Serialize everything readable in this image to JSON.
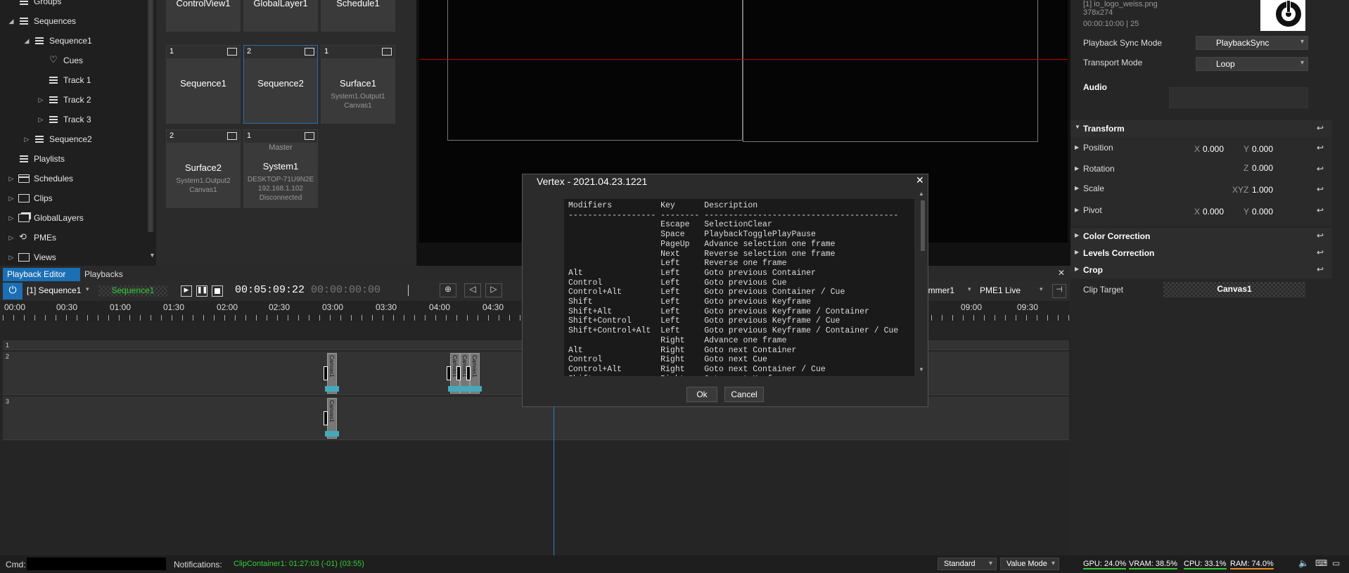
{
  "tree": {
    "items": [
      {
        "label": "Groups",
        "icon": "list-icon",
        "level": 0
      },
      {
        "label": "Sequences",
        "icon": "list-icon",
        "level": 0
      },
      {
        "label": "Sequence1",
        "icon": "list-icon",
        "level": 1
      },
      {
        "label": "Cues",
        "icon": "cue-icon",
        "level": 2
      },
      {
        "label": "Track 1",
        "icon": "list-icon",
        "level": 2
      },
      {
        "label": "Track 2",
        "icon": "list-icon",
        "level": 2
      },
      {
        "label": "Track 3",
        "icon": "list-icon",
        "level": 2
      },
      {
        "label": "Sequence2",
        "icon": "list-icon",
        "level": 1
      },
      {
        "label": "Playlists",
        "icon": "list-icon",
        "level": 0
      },
      {
        "label": "Schedules",
        "icon": "calendar-icon",
        "level": 0
      },
      {
        "label": "Clips",
        "icon": "clip-icon",
        "level": 0
      },
      {
        "label": "GlobalLayers",
        "icon": "layer-icon",
        "level": 0
      },
      {
        "label": "PMEs",
        "icon": "pme-icon",
        "level": 0
      },
      {
        "label": "Views",
        "icon": "view-icon",
        "level": 0
      }
    ]
  },
  "tiles": [
    {
      "name": "ControlView1"
    },
    {
      "name": "GlobalLayer1"
    },
    {
      "name": "Schedule1"
    },
    {
      "num": "1",
      "name": "Sequence1"
    },
    {
      "num": "2",
      "name": "Sequence2"
    },
    {
      "num": "1",
      "name": "Surface1",
      "sub1": "System1.Output1",
      "sub2": "Canvas1"
    },
    {
      "num": "2",
      "name": "Surface2",
      "sub1": "System1.Output2",
      "sub2": "Canvas1"
    },
    {
      "num": "1",
      "head": "Master",
      "name": "System1",
      "sub1": "DESKTOP-71U9N2E",
      "sub2": "192.168.1.102",
      "sub3": "Disconnected"
    }
  ],
  "props": {
    "file_name": "[1] io_logo_weiss.png",
    "file_size": "378x274",
    "file_time": "00:00:10:00 | 25",
    "playback_sync_label": "Playback Sync Mode",
    "playback_sync_value": "PlaybackSync",
    "transport_label": "Transport Mode",
    "transport_value": "Loop",
    "audio_label": "Audio",
    "transform_label": "Transform",
    "position_label": "Position",
    "pos_x_lbl": "X",
    "pos_x": "0.000",
    "pos_y_lbl": "Y",
    "pos_y": "0.000",
    "rotation_label": "Rotation",
    "rot_z_lbl": "Z",
    "rot_z": "0.000",
    "scale_label": "Scale",
    "scale_lbl": "XYZ",
    "scale_val": "1.000",
    "pivot_label": "Pivot",
    "piv_x_lbl": "X",
    "piv_x": "0.000",
    "piv_y_lbl": "Y",
    "piv_y": "0.000",
    "color_correction": "Color Correction",
    "levels_correction": "Levels Correction",
    "crop": "Crop",
    "clip_target_label": "Clip Target",
    "clip_target_value": "Canvas1"
  },
  "editor": {
    "tab1": "Playback Editor",
    "tab2": "Playbacks",
    "sequence_select": "[1] Sequence1",
    "sequence_name": "Sequence1",
    "timecode": "00:05:09:22",
    "timecode2": "00:00:00:00",
    "programmer": "ammer1",
    "pme": "PME1 Live",
    "ruler_ticks": [
      "00:00",
      "00:30",
      "01:00",
      "01:30",
      "02:00",
      "02:30",
      "03:00",
      "03:30",
      "04:00",
      "04:30",
      "0",
      "09:00",
      "09:30"
    ],
    "lanes": [
      "1",
      "2",
      "3"
    ],
    "clip_label": "Canvas1"
  },
  "dialog": {
    "title": "Vertex - 2021.04.23.1221",
    "ok": "Ok",
    "cancel": "Cancel",
    "text": "Modifiers          Key      Description\n------------------ -------- ----------------------------------------\n                   Escape   SelectionClear\n                   Space    PlaybackTogglePlayPause\n                   PageUp   Advance selection one frame\n                   Next     Reverse selection one frame\n                   Left     Reverse one frame\nAlt                Left     Goto previous Container\nControl            Left     Goto previous Cue\nControl+Alt        Left     Goto previous Container / Cue\nShift              Left     Goto previous Keyframe\nShift+Alt          Left     Goto previous Keyframe / Container\nShift+Control      Left     Goto previous Keyframe / Cue\nShift+Control+Alt  Left     Goto previous Keyframe / Container / Cue\n                   Right    Advance one frame\nAlt                Right    Goto next Container\nControl            Right    Goto next Cue\nControl+Alt        Right    Goto next Container / Cue\nShift              Right    Goto next Keyframe"
  },
  "status": {
    "cmd_label": "Cmd:",
    "notifications_label": "Notifications:",
    "notification": "ClipContainer1: 01:27:03 (-01) (03:55)",
    "mode1": "Standard",
    "mode2": "Value Mode",
    "gpu": "GPU: 24.0%",
    "vram": "VRAM: 38.5%",
    "cpu": "CPU: 33.1%",
    "ram": "RAM: 74.0%"
  }
}
